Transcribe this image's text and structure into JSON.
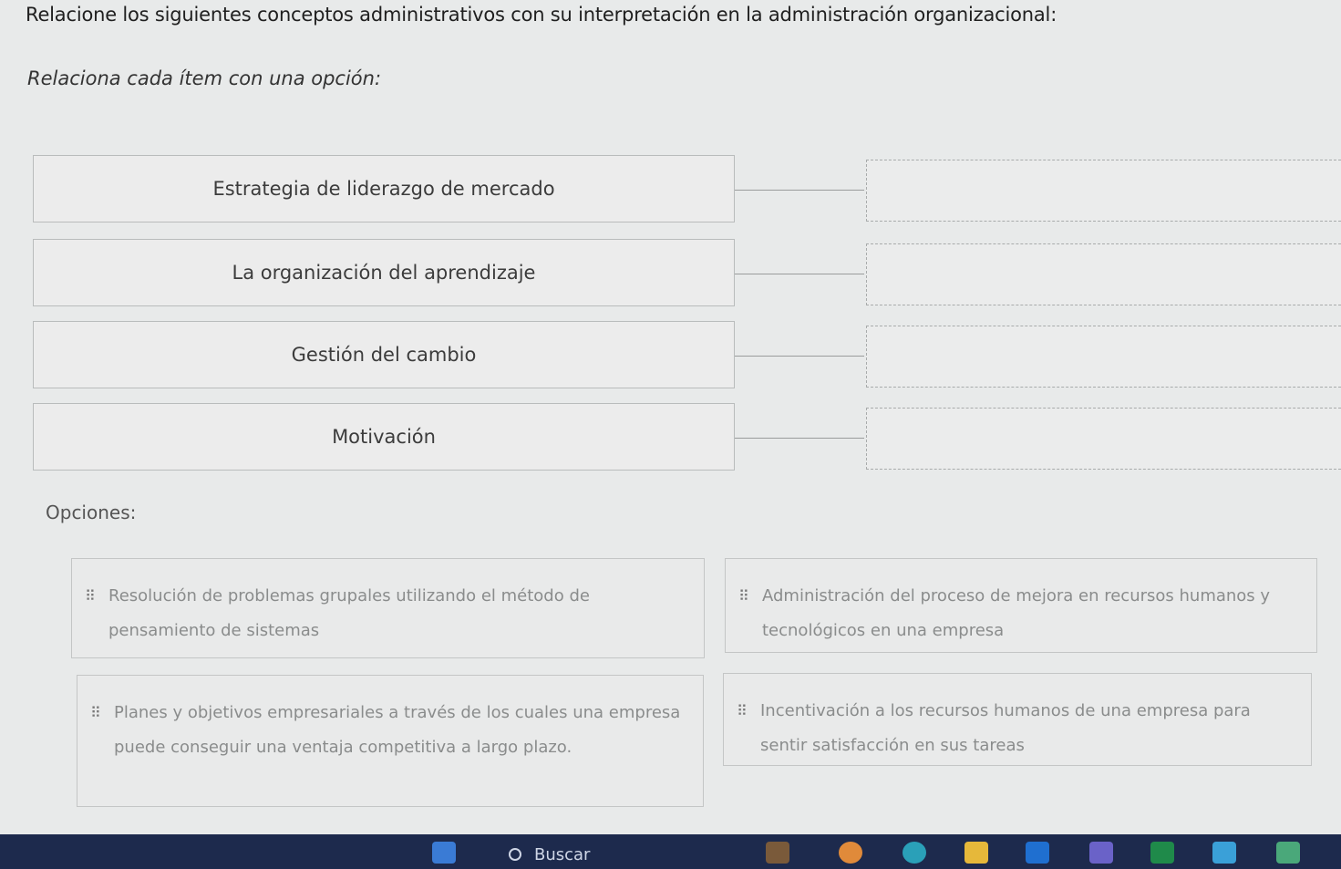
{
  "question": "Relacione los siguientes conceptos administrativos con su interpretación en la administración organizacional:",
  "instruction": "Relaciona cada ítem con una opción:",
  "items": [
    {
      "label": "Estrategia de liderazgo de mercado"
    },
    {
      "label": "La organización del aprendizaje"
    },
    {
      "label": "Gestión del cambio"
    },
    {
      "label": "Motivación"
    }
  ],
  "options_label": "Opciones:",
  "options": [
    {
      "text": "Resolución de problemas grupales utilizando el método de pensamiento de sistemas"
    },
    {
      "text": "Administración del proceso de mejora en recursos humanos y tecnológicos en una empresa"
    },
    {
      "text": "Planes y objetivos empresariales a través de los cuales una empresa puede conseguir una ventaja competitiva a largo plazo."
    },
    {
      "text": "Incentivación a los recursos humanos de una empresa para sentir satisfacción en sus tareas"
    }
  ],
  "drag_handle_glyph": "⠿",
  "taskbar": {
    "search_label": "Buscar",
    "icons": [
      "start-icon",
      "search-icon",
      "widgets-icon",
      "browser-icon",
      "edge-icon",
      "file-explorer-icon",
      "outlook-icon",
      "teams-icon",
      "excel-icon",
      "app-icon"
    ]
  }
}
